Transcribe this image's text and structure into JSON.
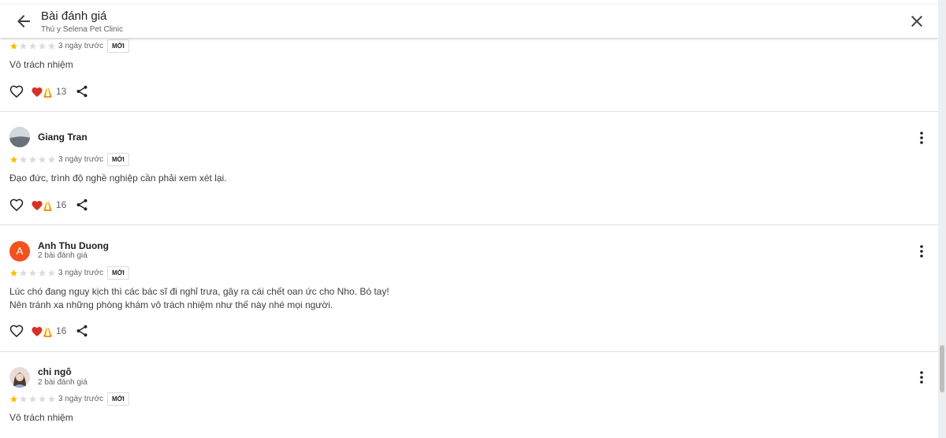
{
  "header": {
    "title": "Bài đánh giá",
    "subtitle": "Thú y Selena Pet Clinic",
    "back_icon": "arrow-left-icon",
    "close_icon": "close-icon"
  },
  "colors": {
    "star_filled": "#fbbc04",
    "star_empty": "#dadce0",
    "heart": "#d93025",
    "avatar_orange": "#f4511e"
  },
  "reviews": [
    {
      "rating": 1,
      "date": "3 ngày trước",
      "badge": "MỚI",
      "text": [
        "Vô trách nhiệm"
      ],
      "reaction_count": "13"
    },
    {
      "name": "Giang Tran",
      "rating": 1,
      "date": "3 ngày trước",
      "badge": "MỚI",
      "text": [
        "Đạo đức, trình độ nghề nghiệp cần phải xem xét lại."
      ],
      "reaction_count": "16"
    },
    {
      "name": "Anh Thu Duong",
      "avatar_letter": "A",
      "meta": "2 bài đánh giá",
      "rating": 1,
      "date": "3 ngày trước",
      "badge": "MỚI",
      "text": [
        "Lúc chó đang nguy kịch thì các bác sĩ đi nghỉ trưa, gây ra cái chết oan ức cho Nho. Bó tay!",
        "Nên tránh xa những phòng khám vô trách nhiệm như thế này nhé mọi người."
      ],
      "reaction_count": "16"
    },
    {
      "name": "chi ngô",
      "meta": "2 bài đánh giá",
      "rating": 1,
      "date": "3 ngày trước",
      "badge": "MỚI",
      "text": [
        "Vô trách nhiệm"
      ]
    }
  ]
}
